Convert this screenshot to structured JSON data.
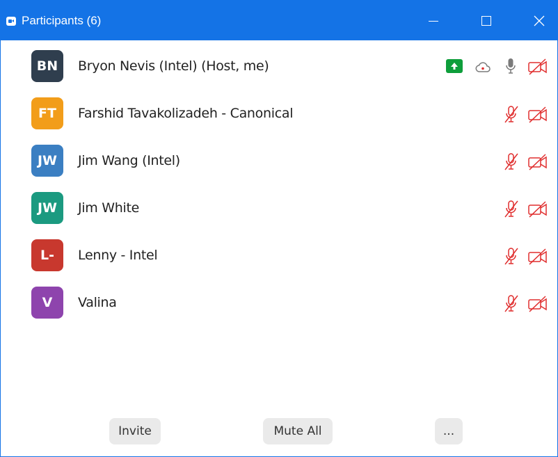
{
  "window": {
    "title": "Participants (6)",
    "accent_color": "#1473e6"
  },
  "participants": [
    {
      "initials": "BN",
      "name": "Bryon Nevis (Intel) (Host, me)",
      "avatar_color": "#2f3e4e",
      "audio": "unmuted",
      "video": "off",
      "sharing": true,
      "recording": true
    },
    {
      "initials": "FT",
      "name": "Farshid Tavakolizadeh - Canonical",
      "avatar_color": "#f29d1a",
      "audio": "muted",
      "video": "off"
    },
    {
      "initials": "JW",
      "name": "Jim Wang (Intel)",
      "avatar_color": "#3b7fc2",
      "audio": "muted",
      "video": "off"
    },
    {
      "initials": "JW",
      "name": "Jim White",
      "avatar_color": "#1b9a80",
      "audio": "muted",
      "video": "off"
    },
    {
      "initials": "L-",
      "name": "Lenny - Intel",
      "avatar_color": "#c8382e",
      "audio": "muted",
      "video": "off"
    },
    {
      "initials": "V",
      "name": "Valina",
      "avatar_color": "#8e44ad",
      "audio": "muted",
      "video": "off"
    }
  ],
  "footer": {
    "invite_label": "Invite",
    "mute_all_label": "Mute All",
    "more_label": "..."
  },
  "icons": {
    "share": "share-screen-icon",
    "record": "cloud-record-icon",
    "mic": "microphone-icon",
    "mic_muted": "microphone-muted-icon",
    "video_off": "video-off-icon"
  },
  "status_colors": {
    "muted": "#e02f2f",
    "sharing": "#0e9e3b",
    "neutral": "#7a7a7a"
  }
}
